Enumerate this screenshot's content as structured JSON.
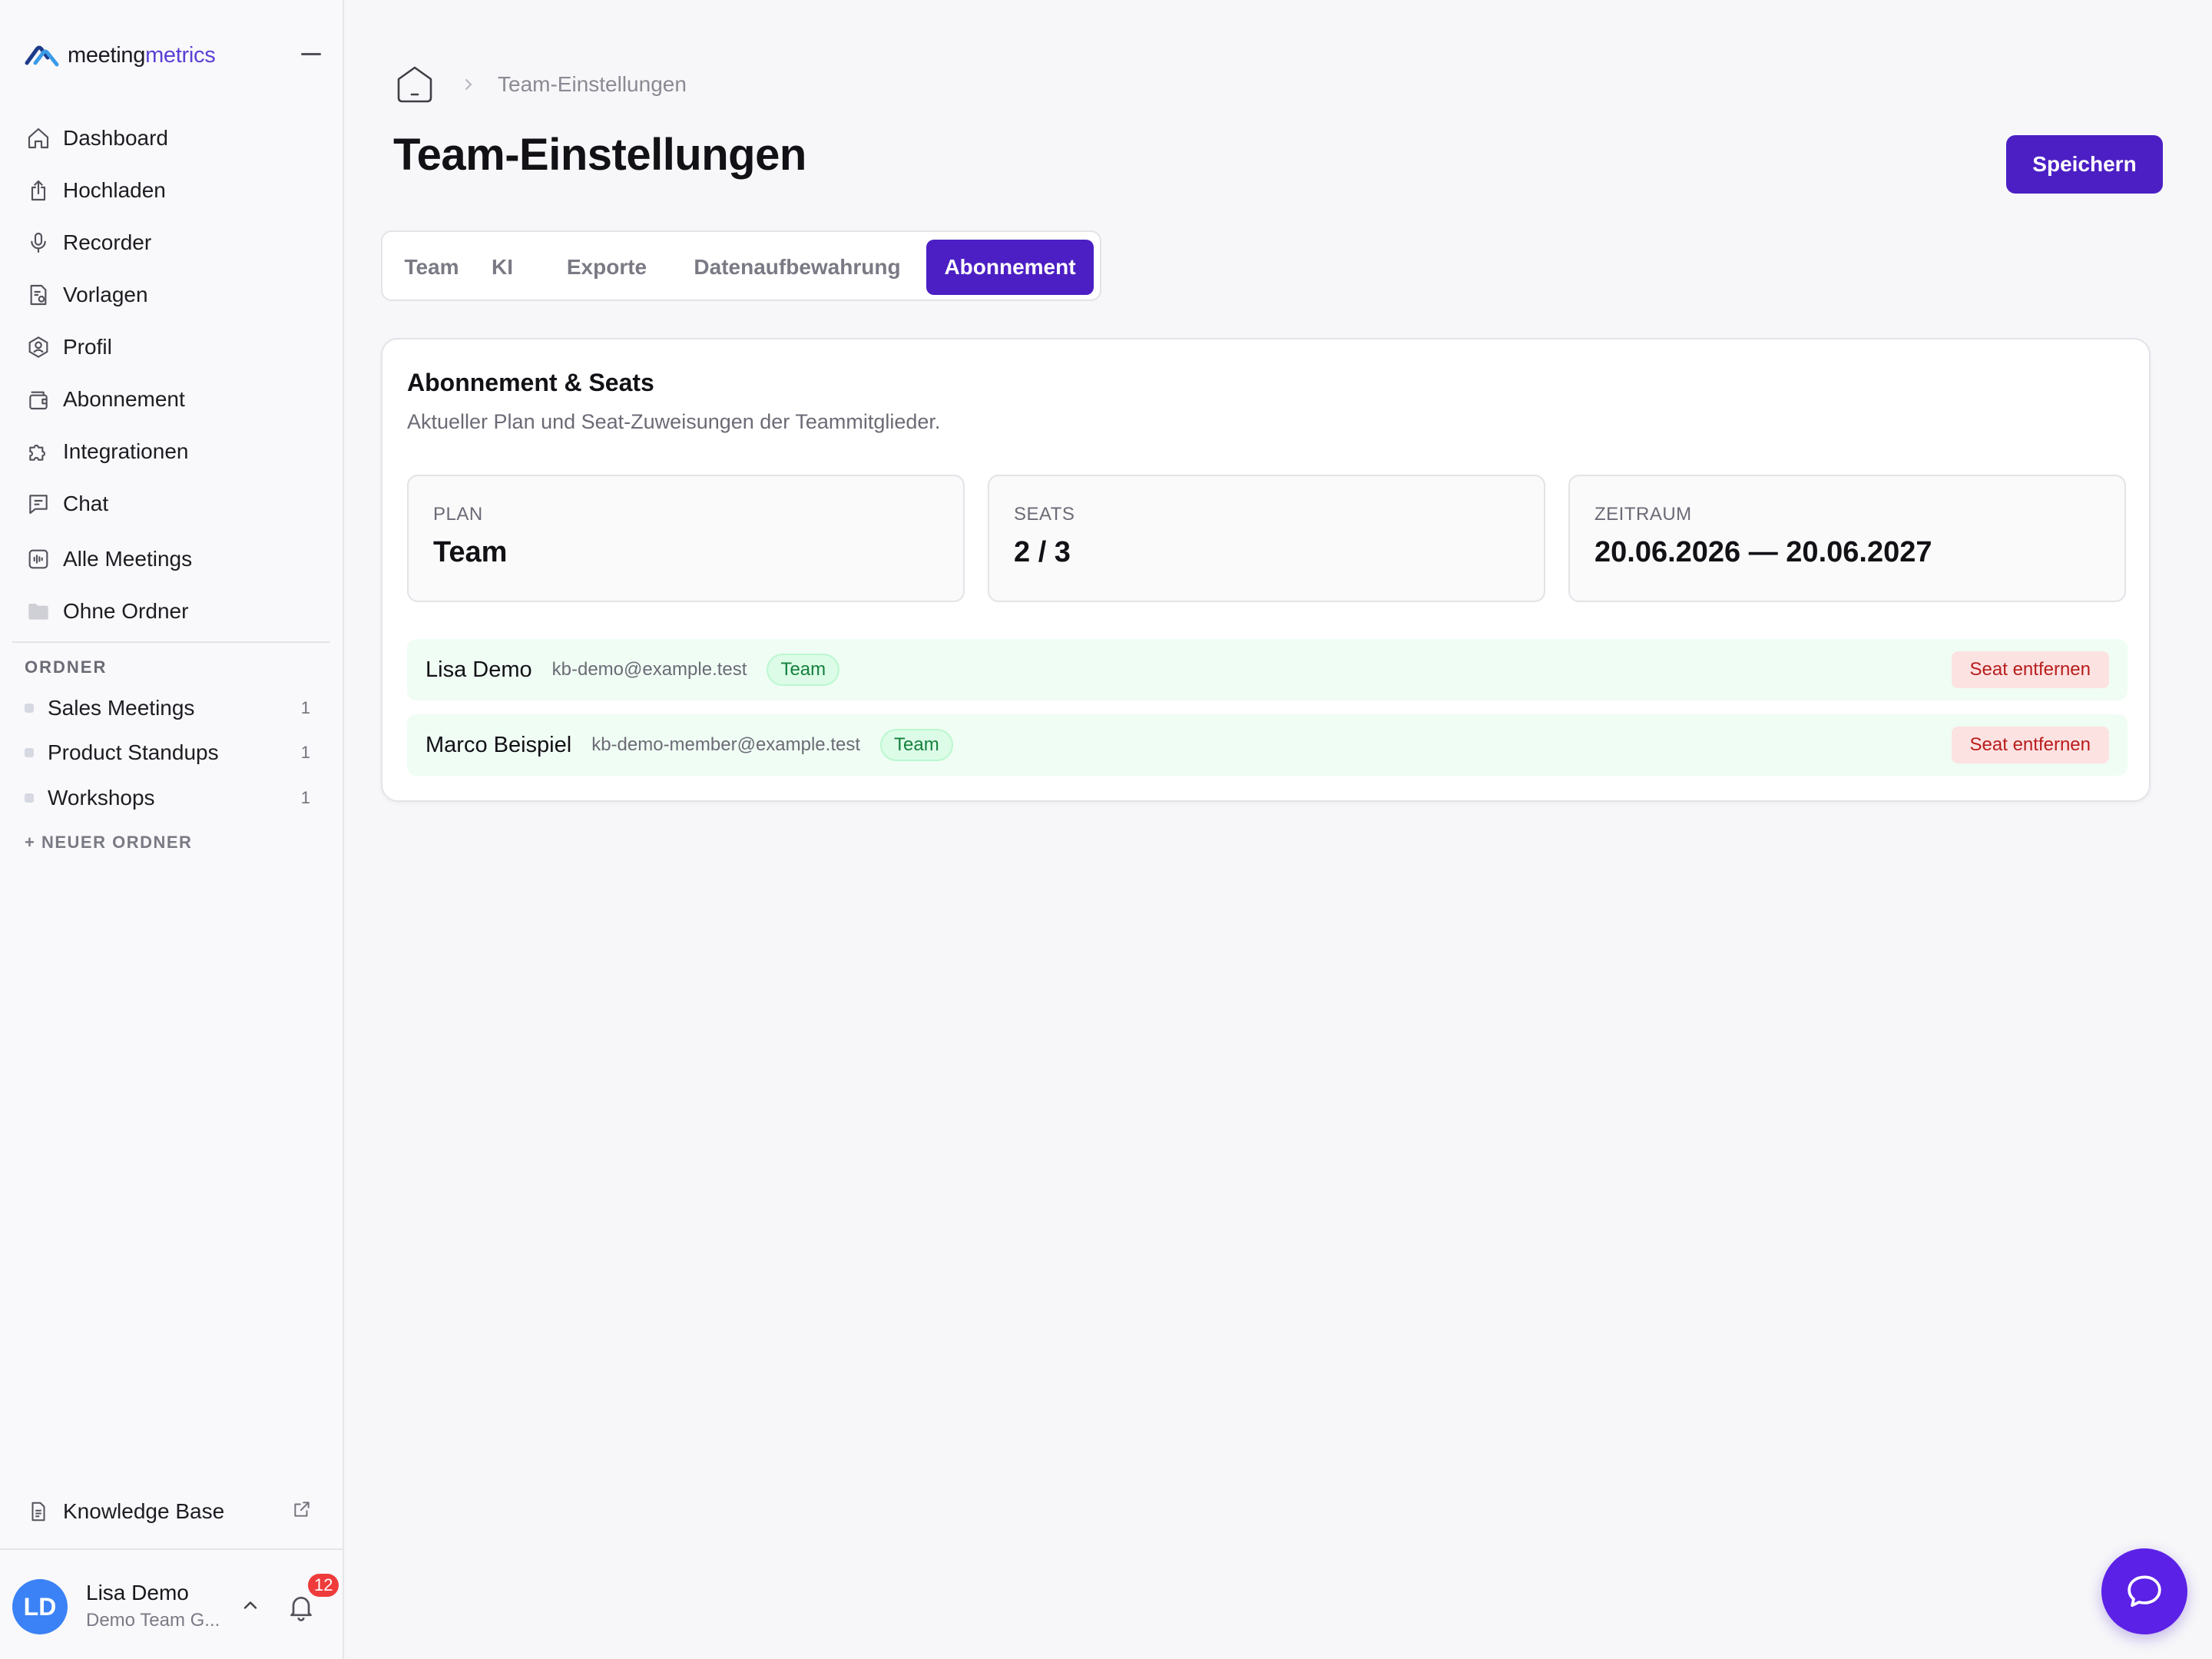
{
  "app": {
    "logo_text_main": "meeting",
    "logo_text_accent": "metrics",
    "brand_color": "#4c1fc4"
  },
  "sidebar": {
    "nav": [
      {
        "label": "Dashboard",
        "icon": "home-icon"
      },
      {
        "label": "Hochladen",
        "icon": "upload-icon"
      },
      {
        "label": "Recorder",
        "icon": "microphone-icon"
      },
      {
        "label": "Vorlagen",
        "icon": "template-icon"
      },
      {
        "label": "Profil",
        "icon": "profile-icon"
      },
      {
        "label": "Abonnement",
        "icon": "wallet-icon"
      },
      {
        "label": "Integrationen",
        "icon": "puzzle-icon"
      },
      {
        "label": "Chat",
        "icon": "chat-icon"
      },
      {
        "label": "Alle Meetings",
        "icon": "audio-file-icon"
      },
      {
        "label": "Ohne Ordner",
        "icon": "folder-icon"
      }
    ],
    "folders_title": "ORDNER",
    "folders": [
      {
        "label": "Sales Meetings",
        "count": "1"
      },
      {
        "label": "Product Standups",
        "count": "1"
      },
      {
        "label": "Workshops",
        "count": "1"
      }
    ],
    "new_folder": "+ NEUER ORDNER",
    "knowledge_base": "Knowledge Base",
    "user": {
      "initials": "LD",
      "name": "Lisa Demo",
      "team": "Demo Team G...",
      "notifications": "12"
    }
  },
  "main": {
    "breadcrumb_current": "Team-Einstellungen",
    "title": "Team-Einstellungen",
    "save_label": "Speichern",
    "tabs": [
      {
        "label": "Team",
        "active": false
      },
      {
        "label": "KI",
        "active": false
      },
      {
        "label": "Exporte",
        "active": false
      },
      {
        "label": "Datenaufbewahrung",
        "active": false
      },
      {
        "label": "Abonnement",
        "active": true
      }
    ],
    "card": {
      "title": "Abonnement & Seats",
      "subtitle": "Aktueller Plan und Seat-Zuweisungen der Teammitglieder.",
      "stats": [
        {
          "label": "PLAN",
          "value": "Team"
        },
        {
          "label": "SEATS",
          "value": "2 / 3"
        },
        {
          "label": "ZEITRAUM",
          "value": "20.06.2026 — 20.06.2027"
        }
      ],
      "members": [
        {
          "name": "Lisa Demo",
          "email": "kb-demo@example.test",
          "badge": "Team",
          "action": "Seat entfernen"
        },
        {
          "name": "Marco Beispiel",
          "email": "kb-demo-member@example.test",
          "badge": "Team",
          "action": "Seat entfernen"
        }
      ]
    }
  }
}
